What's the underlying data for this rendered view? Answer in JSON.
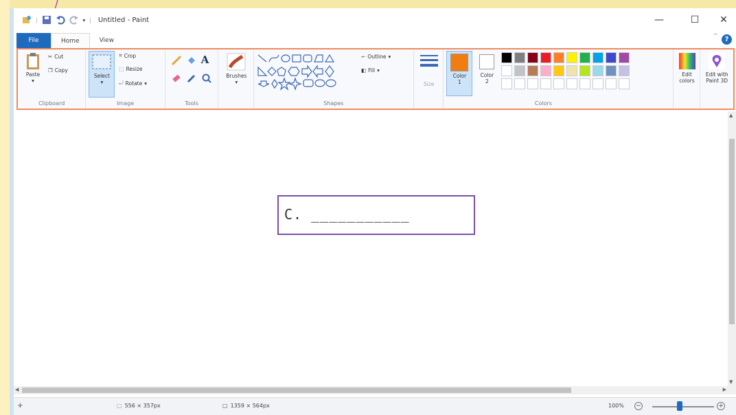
{
  "titlebar": {
    "title": "Untitled - Paint",
    "minimize": "—",
    "maximize": "☐",
    "close": "✕"
  },
  "tabs": [
    {
      "label": "File"
    },
    {
      "label": "Home"
    },
    {
      "label": "View"
    }
  ],
  "help": {
    "glyph": "?",
    "chevron": "^"
  },
  "ribbon": {
    "clipboard": {
      "label": "Clipboard",
      "paste": "Paste",
      "cut": "Cut",
      "copy": "Copy"
    },
    "image": {
      "label": "Image",
      "select": "Select",
      "crop": "Crop",
      "resize": "Resize",
      "rotate": "Rotate"
    },
    "tools": {
      "label": "Tools",
      "text_glyph": "A"
    },
    "brushes": {
      "label": "Brushes"
    },
    "shapes": {
      "label": "Shapes",
      "outline": "Outline",
      "fill": "Fill"
    },
    "size": {
      "label": "Size"
    },
    "colors": {
      "label": "Colors",
      "color1": "Color",
      "color1_num": "1",
      "color2": "Color",
      "color2_num": "2",
      "edit_colors_1": "Edit",
      "edit_colors_2": "colors",
      "paint3d_1": "Edit with",
      "paint3d_2": "Paint 3D",
      "color1_value": "#f07d10",
      "color2_value": "#ffffff",
      "palette_row1": [
        "#000000",
        "#7f7f7f",
        "#880015",
        "#ed1c24",
        "#ff7f27",
        "#fff200",
        "#22b14c",
        "#00a2e8",
        "#3f48cc",
        "#a349a4"
      ],
      "palette_row2": [
        "#ffffff",
        "#c3c3c3",
        "#b97a57",
        "#ffaec9",
        "#ffc90e",
        "#efe4b0",
        "#b5e61d",
        "#99d9ea",
        "#7092be",
        "#c8bfe7"
      ]
    }
  },
  "canvas": {
    "text": "C. ___________"
  },
  "status": {
    "selection_size": "556 × 357px",
    "canvas_size": "1359 × 564px",
    "zoom": "100%",
    "zoom_out": "−",
    "zoom_in": "+"
  }
}
